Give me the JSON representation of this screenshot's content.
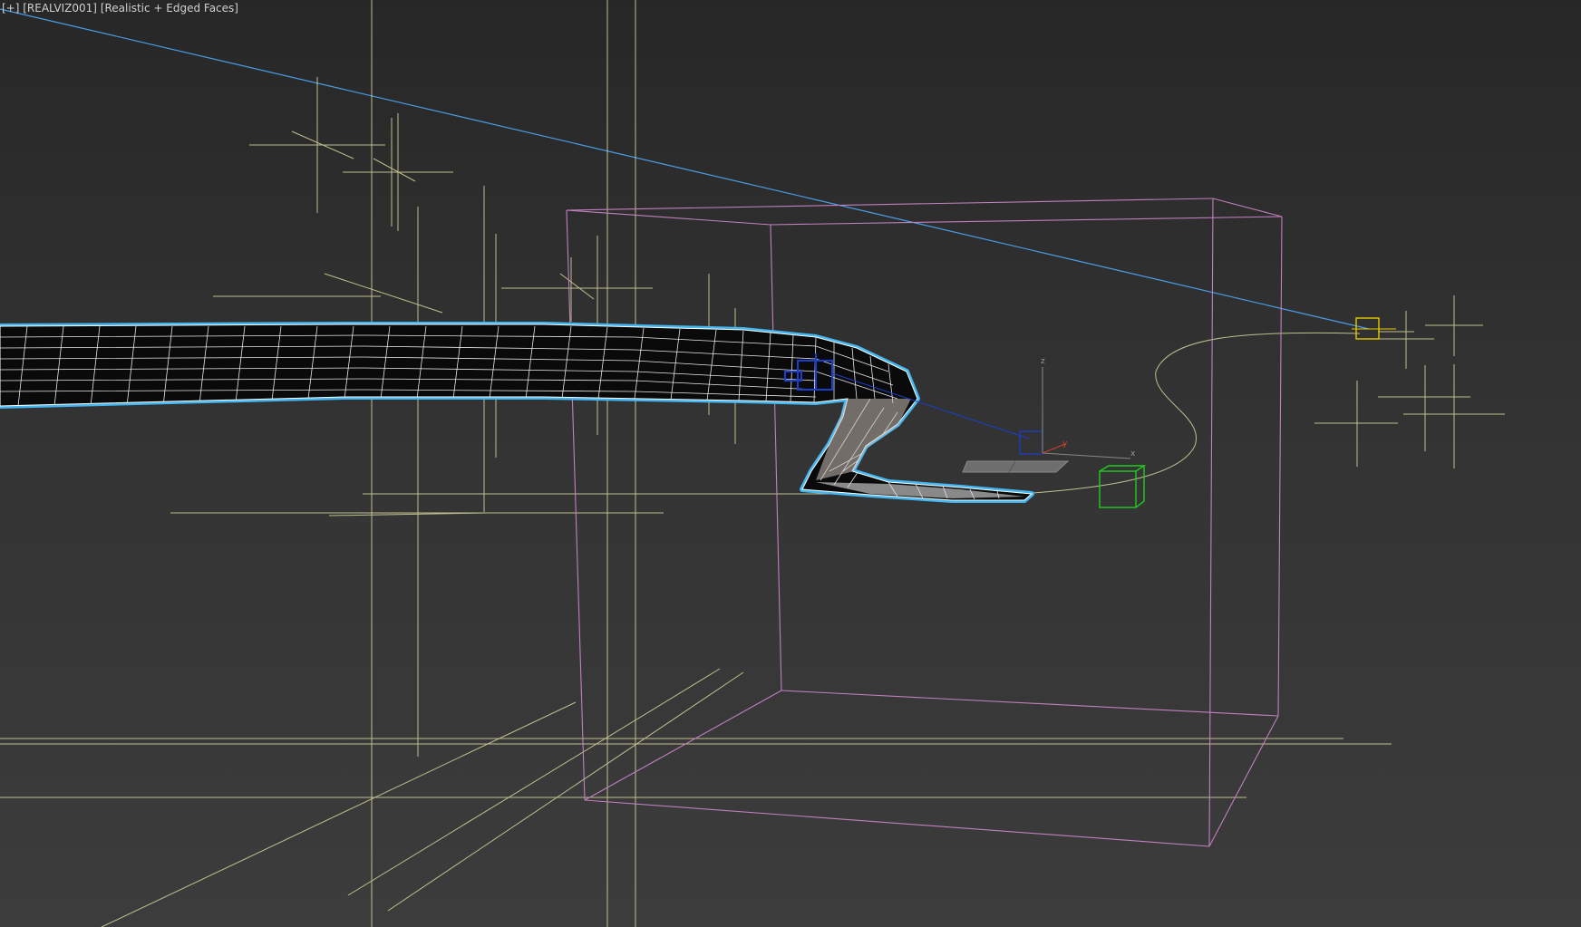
{
  "viewport": {
    "menus": [
      {
        "label": "[+]"
      },
      {
        "label": "[REALVIZ001]"
      },
      {
        "label": "[Realistic + Edged Faces]"
      }
    ],
    "axes": {
      "z": "z",
      "y": "y",
      "x": "x"
    }
  },
  "colors": {
    "background_top": "#272727",
    "background_bottom": "#3c3c3c",
    "helper_lines": "#d8d8a0",
    "bounding_box": "#c080c0",
    "target_line": "#4a9ee8",
    "selection_outline": "#44b6f2",
    "mesh_fill": "#0a0a0a",
    "mesh_edges": "#f0f0f0",
    "light_gizmo": "#e6c800",
    "green_box": "#22cc22",
    "blue_gizmo": "#1a3fd0"
  }
}
